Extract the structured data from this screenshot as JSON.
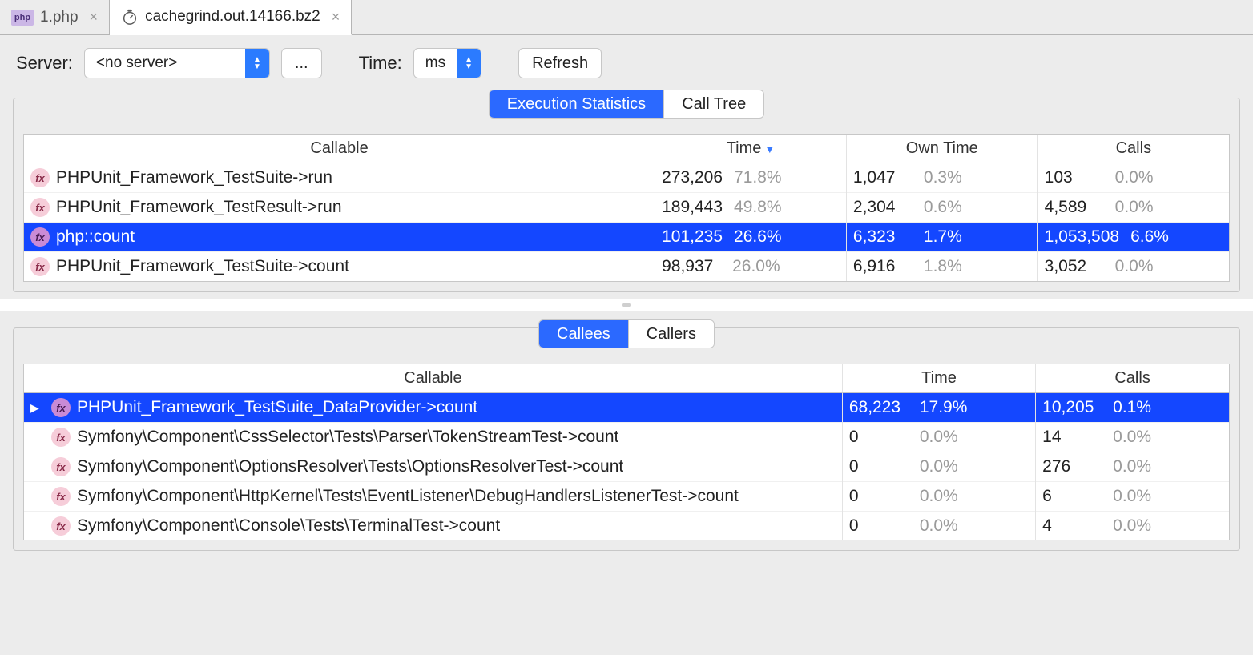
{
  "tabs": [
    {
      "label": "1.php",
      "icon": "php",
      "active": false
    },
    {
      "label": "cachegrind.out.14166.bz2",
      "icon": "stopwatch",
      "active": true
    }
  ],
  "toolbar": {
    "server_label": "Server:",
    "server_value": "<no server>",
    "ellipsis": "...",
    "time_label": "Time:",
    "time_value": "ms",
    "refresh": "Refresh"
  },
  "view_tabs": {
    "exec_stats": "Execution Statistics",
    "call_tree": "Call Tree"
  },
  "top_table": {
    "headers": {
      "callable": "Callable",
      "time": "Time",
      "own_time": "Own Time",
      "calls": "Calls"
    },
    "rows": [
      {
        "name": "PHPUnit_Framework_TestSuite->run",
        "time": "273,206",
        "time_pct": "71.8%",
        "own": "1,047",
        "own_pct": "0.3%",
        "calls": "103",
        "calls_pct": "0.0%",
        "selected": false
      },
      {
        "name": "PHPUnit_Framework_TestResult->run",
        "time": "189,443",
        "time_pct": "49.8%",
        "own": "2,304",
        "own_pct": "0.6%",
        "calls": "4,589",
        "calls_pct": "0.0%",
        "selected": false
      },
      {
        "name": "php::count",
        "time": "101,235",
        "time_pct": "26.6%",
        "own": "6,323",
        "own_pct": "1.7%",
        "calls": "1,053,508",
        "calls_pct": "6.6%",
        "selected": true
      },
      {
        "name": "PHPUnit_Framework_TestSuite->count",
        "time": "98,937",
        "time_pct": "26.0%",
        "own": "6,916",
        "own_pct": "1.8%",
        "calls": "3,052",
        "calls_pct": "0.0%",
        "selected": false
      }
    ]
  },
  "detail_tabs": {
    "callees": "Callees",
    "callers": "Callers"
  },
  "bottom_table": {
    "headers": {
      "callable": "Callable",
      "time": "Time",
      "calls": "Calls"
    },
    "rows": [
      {
        "arrow": true,
        "name": "PHPUnit_Framework_TestSuite_DataProvider->count",
        "time": "68,223",
        "time_pct": "17.9%",
        "calls": "10,205",
        "calls_pct": "0.1%",
        "selected": true
      },
      {
        "arrow": false,
        "name": "Symfony\\Component\\CssSelector\\Tests\\Parser\\TokenStreamTest->count",
        "time": "0",
        "time_pct": "0.0%",
        "calls": "14",
        "calls_pct": "0.0%",
        "selected": false
      },
      {
        "arrow": false,
        "name": "Symfony\\Component\\OptionsResolver\\Tests\\OptionsResolverTest->count",
        "time": "0",
        "time_pct": "0.0%",
        "calls": "276",
        "calls_pct": "0.0%",
        "selected": false
      },
      {
        "arrow": false,
        "name": "Symfony\\Component\\HttpKernel\\Tests\\EventListener\\DebugHandlersListenerTest->count",
        "time": "0",
        "time_pct": "0.0%",
        "calls": "6",
        "calls_pct": "0.0%",
        "selected": false
      },
      {
        "arrow": false,
        "name": "Symfony\\Component\\Console\\Tests\\TerminalTest->count",
        "time": "0",
        "time_pct": "0.0%",
        "calls": "4",
        "calls_pct": "0.0%",
        "selected": false
      }
    ]
  }
}
